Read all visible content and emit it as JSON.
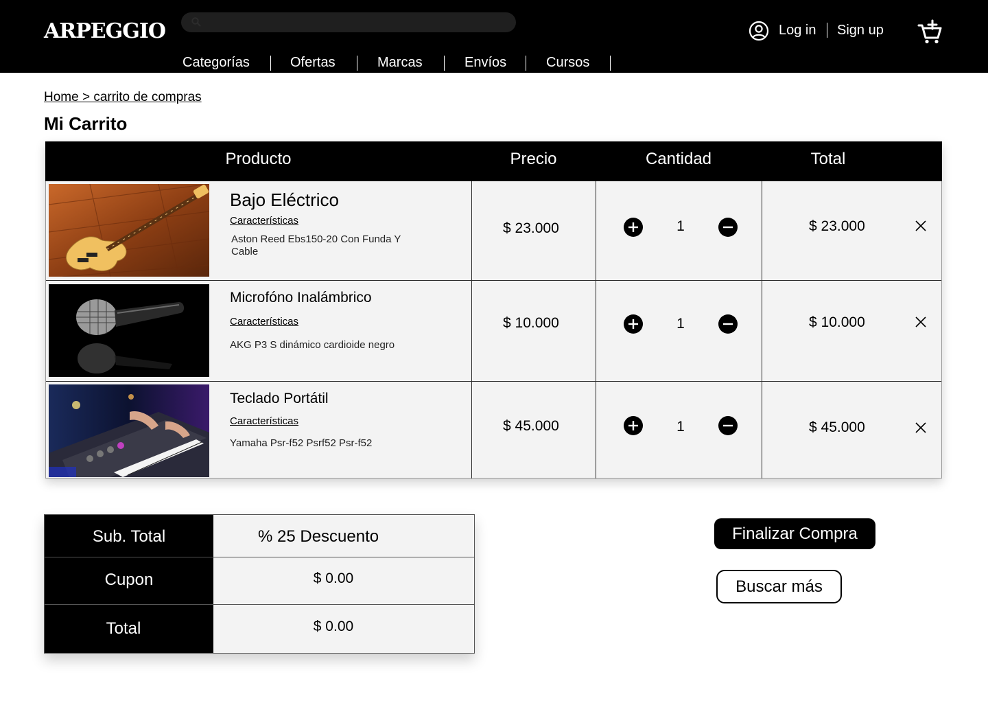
{
  "header": {
    "logo": "ARPEGGIO",
    "search_placeholder": "",
    "nav": [
      "Categorías",
      "Ofertas",
      "Marcas",
      "Envíos",
      "Cursos"
    ],
    "login": "Log in",
    "signup": "Sign up"
  },
  "breadcrumb": "Home > carrito de compras",
  "page_title": "Mi Carrito",
  "table": {
    "headers": [
      "Producto",
      "Precio",
      "Cantidad",
      "Total"
    ],
    "rows": [
      {
        "name": "Bajo Eléctrico",
        "features_label": "Características",
        "description": "Aston Reed Ebs150-20 Con Funda Y Cable",
        "price": "$ 23.000",
        "quantity": "1",
        "total": "$ 23.000",
        "image": "bass-guitar-image"
      },
      {
        "name": "Microfóno Inalámbrico",
        "features_label": "Características",
        "description": "AKG P3 S dinámico cardioide negro",
        "price": "$ 10.000",
        "quantity": "1",
        "total": "$ 10.000",
        "image": "microphone-image"
      },
      {
        "name": "Teclado Portátil",
        "features_label": "Características",
        "description": "Yamaha Psr-f52 Psrf52 Psr-f52",
        "price": "$ 45.000",
        "quantity": "1",
        "total": "$ 45.000",
        "image": "keyboard-image"
      }
    ]
  },
  "summary": {
    "subtotal_label": "Sub. Total",
    "subtotal_value": "% 25 Descuento",
    "coupon_label": "Cupon",
    "coupon_value": "$ 0.00",
    "total_label": "Total",
    "total_value": "$ 0.00"
  },
  "actions": {
    "checkout": "Finalizar Compra",
    "search_more": "Buscar más"
  },
  "icons": {
    "search": "search-icon",
    "user": "user-circle-icon",
    "cart": "cart-add-icon",
    "plus": "plus-circle-icon",
    "minus": "minus-circle-icon",
    "remove": "close-icon"
  }
}
